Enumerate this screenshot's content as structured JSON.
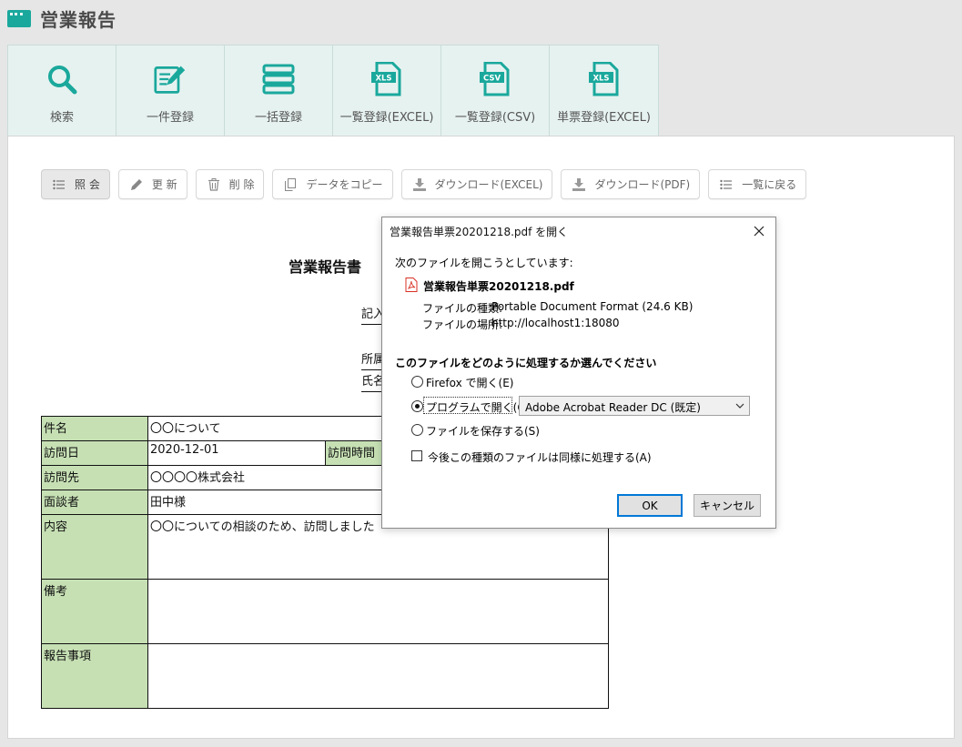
{
  "app": {
    "title": "営業報告"
  },
  "tiles": [
    {
      "label": "検索",
      "icon": "search-icon"
    },
    {
      "label": "一件登録",
      "icon": "edit-form-icon"
    },
    {
      "label": "一括登録",
      "icon": "list-stack-icon"
    },
    {
      "label": "一覧登録(EXCEL)",
      "icon": "xls-file-icon",
      "badge": "XLS"
    },
    {
      "label": "一覧登録(CSV)",
      "icon": "csv-file-icon",
      "badge": "CSV"
    },
    {
      "label": "単票登録(EXCEL)",
      "icon": "xls-file-icon",
      "badge": "XLS"
    }
  ],
  "toolbar": {
    "view": "照 会",
    "update": "更 新",
    "delete": "削 除",
    "copy": "データをコピー",
    "download_excel": "ダウンロード(EXCEL)",
    "download_pdf": "ダウンロード(PDF)",
    "back_to_list": "一覧に戻る"
  },
  "report": {
    "title": "営業報告書",
    "meta": {
      "entry_prefix": "記入",
      "dept_prefix": "所属",
      "name_prefix": "氏名"
    },
    "rows": {
      "subject_label": "件名",
      "subject_value": "〇〇について",
      "visit_date_label": "訪問日",
      "visit_date_value": "2020-12-01",
      "visit_time_label": "訪問時間",
      "destination_label": "訪問先",
      "destination_value": "〇〇〇〇株式会社",
      "interviewee_label": "面談者",
      "interviewee_value": "田中様",
      "content_label": "内容",
      "content_value": "〇〇についての相談のため、訪問しました",
      "remarks_label": "備考",
      "report_items_label": "報告事項"
    }
  },
  "dialog": {
    "title": "営業報告単票20201218.pdf を開く",
    "intro": "次のファイルを開こうとしています:",
    "filename": "営業報告単票20201218.pdf",
    "type_label": "ファイルの種類:",
    "type_value": "Portable Document Format (24.6 KB)",
    "location_label": "ファイルの場所:",
    "location_value": "http://localhost1:18080",
    "question": "このファイルをどのように処理するか選んでください",
    "option_firefox": "Firefox で開く(E)",
    "option_program": "プログラムで開く(O):",
    "program_selected": "Adobe Acrobat Reader DC (既定)",
    "option_save": "ファイルを保存する(S)",
    "remember": "今後この種類のファイルは同様に処理する(A)",
    "ok": "OK",
    "cancel": "キャンセル",
    "selected_option": "program"
  },
  "colors": {
    "accent": "#1aa89c",
    "label_bg": "#c6e0b4",
    "focus": "#0078d7"
  }
}
